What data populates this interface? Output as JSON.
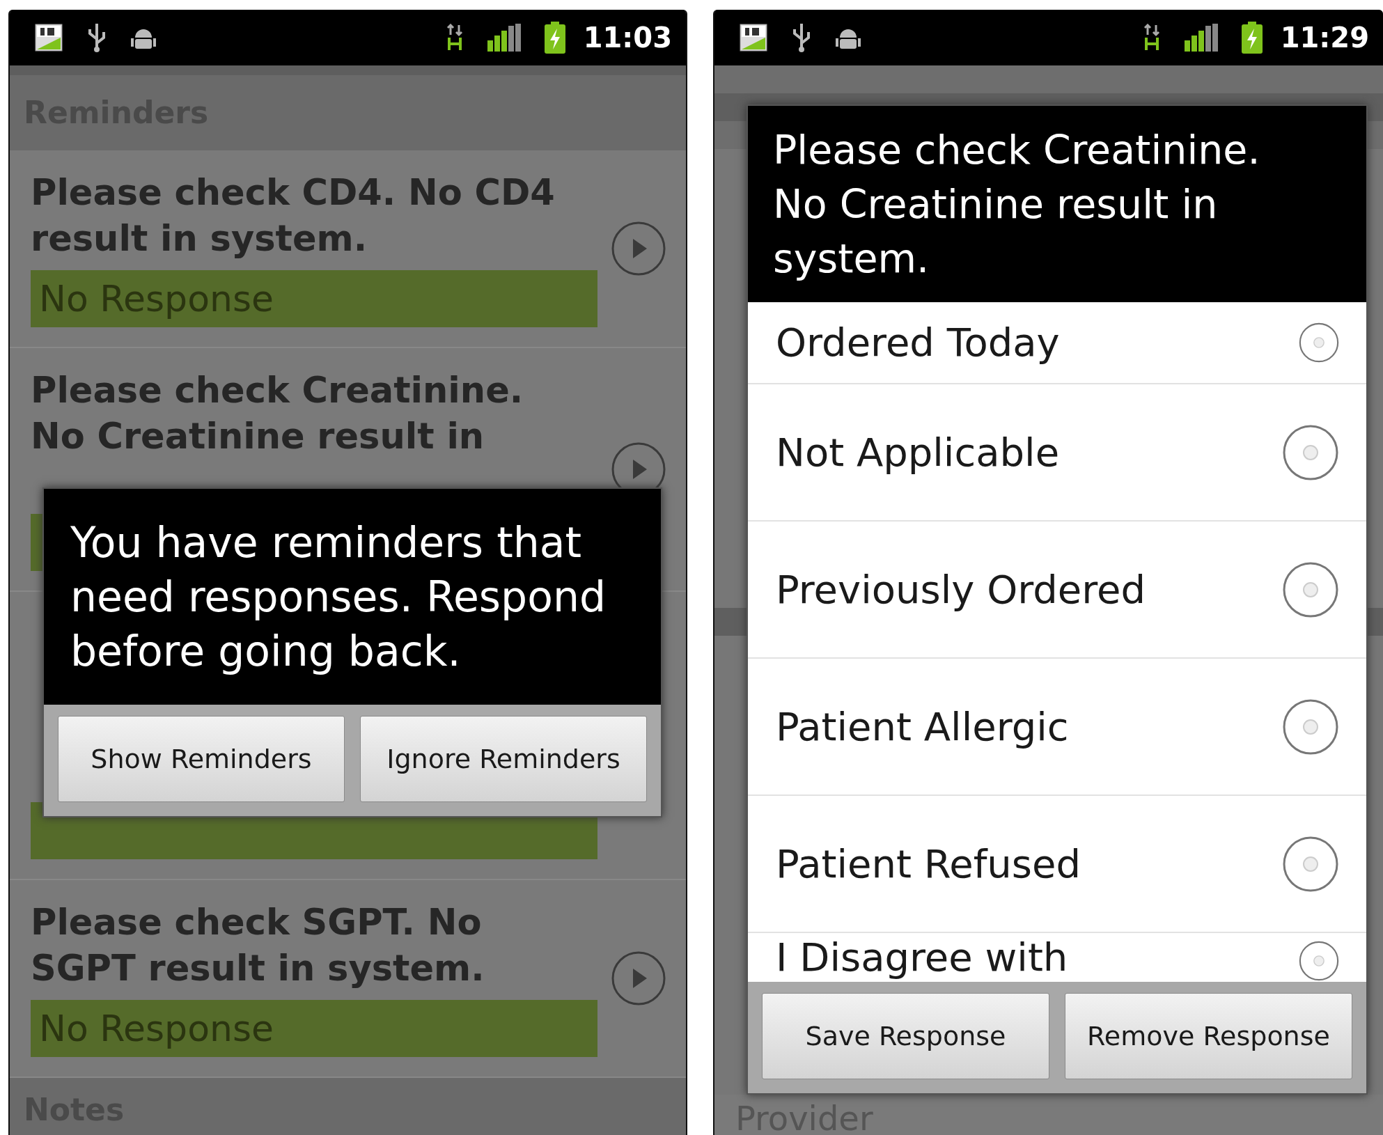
{
  "left_screen": {
    "status_bar": {
      "time": "11:03"
    },
    "header": "Reminders",
    "reminders": [
      {
        "kind": "shown",
        "text": "Please check CD4. No CD4 result in system.",
        "response": "No Response"
      },
      {
        "kind": "shown",
        "text": "Please check Creatinine. No Creatinine result in"
      },
      {
        "kind": "hidden"
      },
      {
        "kind": "shown",
        "text": "Please check SGPT. No SGPT result in system.",
        "response": "No Response"
      }
    ],
    "notes_header": "Notes",
    "dialog": {
      "message": "You have reminders that need responses. Respond before going back.",
      "buttons": [
        "Show Reminders",
        "Ignore Reminders"
      ]
    }
  },
  "right_screen": {
    "status_bar": {
      "time": "11:29"
    },
    "background_text": "Provider",
    "dialog": {
      "title": "Please check Creatinine. No Creatinine result in system.",
      "options": [
        {
          "label": "Ordered Today",
          "selected": false,
          "kind": "partial_top"
        },
        {
          "label": "Not Applicable",
          "selected": false,
          "kind": "full"
        },
        {
          "label": "Previously Ordered",
          "selected": false,
          "kind": "full"
        },
        {
          "label": "Patient Allergic",
          "selected": false,
          "kind": "full"
        },
        {
          "label": "Patient Refused",
          "selected": false,
          "kind": "full"
        },
        {
          "label": "I Disagree with",
          "selected": false,
          "kind": "partial_bottom"
        }
      ],
      "buttons": [
        "Save Response",
        "Remove Response"
      ]
    }
  }
}
